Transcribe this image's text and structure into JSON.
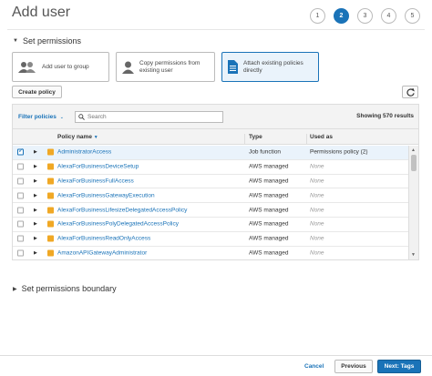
{
  "header": {
    "title": "Add user",
    "steps": [
      "1",
      "2",
      "3",
      "4",
      "5"
    ],
    "active_step": 2
  },
  "permissions": {
    "section_title": "Set permissions",
    "options": [
      {
        "label": "Add user to group",
        "icon": "group-icon",
        "selected": false
      },
      {
        "label": "Copy permissions from existing user",
        "icon": "user-icon",
        "selected": false
      },
      {
        "label": "Attach existing policies directly",
        "icon": "document-icon",
        "selected": true
      }
    ],
    "create_policy_label": "Create policy",
    "refresh_icon": "refresh-icon"
  },
  "table": {
    "filter_label": "Filter policies",
    "search_placeholder": "Search",
    "showing": "Showing 570 results",
    "columns": {
      "name": "Policy name",
      "type": "Type",
      "used_as": "Used as"
    },
    "rows": [
      {
        "name": "AdministratorAccess",
        "type": "Job function",
        "used_as": "Permissions policy (2)",
        "checked": true
      },
      {
        "name": "AlexaForBusinessDeviceSetup",
        "type": "AWS managed",
        "used_as": "None",
        "checked": false
      },
      {
        "name": "AlexaForBusinessFullAccess",
        "type": "AWS managed",
        "used_as": "None",
        "checked": false
      },
      {
        "name": "AlexaForBusinessGatewayExecution",
        "type": "AWS managed",
        "used_as": "None",
        "checked": false
      },
      {
        "name": "AlexaForBusinessLifesizeDelegatedAccessPolicy",
        "type": "AWS managed",
        "used_as": "None",
        "checked": false
      },
      {
        "name": "AlexaForBusinessPolyDelegatedAccessPolicy",
        "type": "AWS managed",
        "used_as": "None",
        "checked": false
      },
      {
        "name": "AlexaForBusinessReadOnlyAccess",
        "type": "AWS managed",
        "used_as": "None",
        "checked": false
      },
      {
        "name": "AmazonAPIGatewayAdministrator",
        "type": "AWS managed",
        "used_as": "None",
        "checked": false
      }
    ]
  },
  "boundary": {
    "section_title": "Set permissions boundary"
  },
  "footer": {
    "cancel_label": "Cancel",
    "previous_label": "Previous",
    "next_label": "Next: Tags"
  },
  "colors": {
    "accent": "#1a73b8",
    "policy_icon": "#f0a825"
  }
}
